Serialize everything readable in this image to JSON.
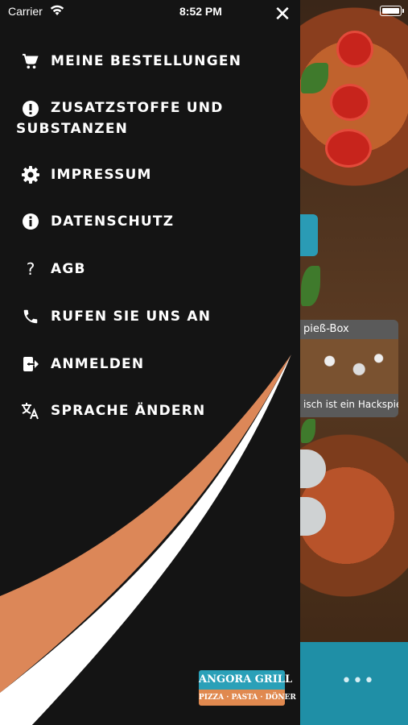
{
  "status_bar": {
    "carrier": "Carrier",
    "time": "8:52 PM"
  },
  "drawer": {
    "close_icon": "close-icon",
    "menu_items": [
      {
        "label": "MEINE BESTELLUNGEN",
        "icon": "cart-icon"
      },
      {
        "label": "ZUSATZSTOFFE UND SUBSTANZEN",
        "icon": "alert-circle-icon"
      },
      {
        "label": "IMPRESSUM",
        "icon": "gear-icon"
      },
      {
        "label": "DATENSCHUTZ",
        "icon": "info-icon"
      },
      {
        "label": "AGB",
        "icon": "question-icon"
      },
      {
        "label": "RUFEN SIE UNS AN",
        "icon": "phone-icon"
      },
      {
        "label": "ANMELDEN",
        "icon": "login-icon"
      },
      {
        "label": "SPRACHE ÄNDERN",
        "icon": "translate-icon"
      }
    ],
    "logo": {
      "name": "ANGORA GRILL",
      "tagline": "PIZZA · PASTA · DÖNER"
    }
  },
  "background": {
    "card_title": "pieß-Box",
    "card_description": "isch ist ein Hackspie…",
    "more_label": "•••"
  },
  "colors": {
    "drawer_bg": "#141414",
    "accent_orange": "#dc8758",
    "accent_teal": "#1f8fa6"
  }
}
